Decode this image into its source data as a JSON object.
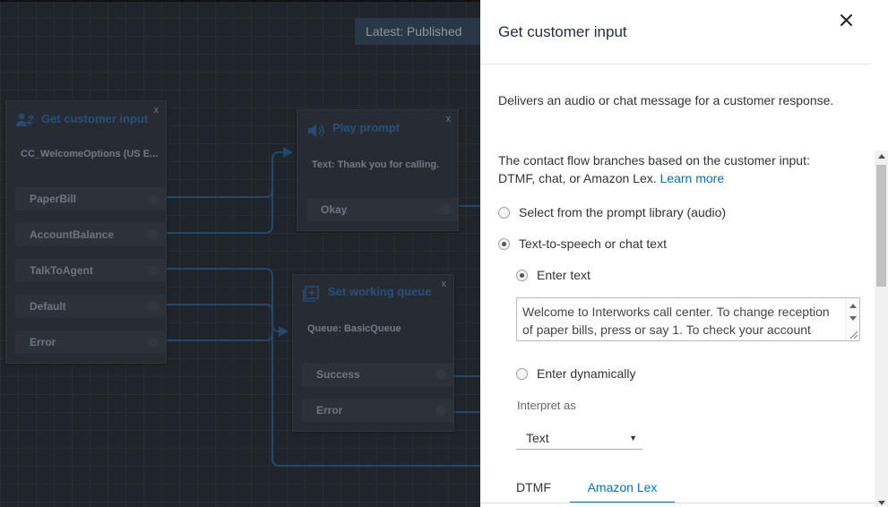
{
  "canvas": {
    "version_badge": "Latest: Published",
    "blocks": {
      "get_customer_input": {
        "title": "Get customer input",
        "subtitle": "CC_WelcomeOptions (US E...",
        "branches": [
          "PaperBill",
          "AccountBalance",
          "TalkToAgent",
          "Default",
          "Error"
        ]
      },
      "play_prompt": {
        "title": "Play prompt",
        "subtitle": "Text: Thank you for calling.",
        "branches": [
          "Okay"
        ]
      },
      "set_working_queue": {
        "title": "Set working queue",
        "subtitle": "Queue: BasicQueue",
        "branches": [
          "Success",
          "Error"
        ]
      }
    },
    "close_glyph": "x"
  },
  "panel": {
    "title": "Get customer input",
    "description": "Delivers an audio or chat message for a customer response.",
    "branch_text": "The contact flow branches based on the customer input: DTMF, chat, or Amazon Lex.",
    "learn_more": "Learn more",
    "source_options": [
      {
        "label": "Select from the prompt library (audio)",
        "selected": false
      },
      {
        "label": "Text-to-speech or chat text",
        "selected": true
      }
    ],
    "text_options": [
      {
        "label": "Enter text",
        "selected": true
      },
      {
        "label": "Enter dynamically",
        "selected": false
      }
    ],
    "text_value": "Welcome to Interworks call center. To change reception of paper bills, press or say 1. To check your account",
    "interpret_label": "Interpret as",
    "interpret_value": "Text",
    "caret": "▼",
    "tabs": [
      {
        "label": "DTMF",
        "active": false
      },
      {
        "label": "Amazon Lex",
        "active": true
      }
    ]
  },
  "colors": {
    "link": "#0073bb",
    "block_title": "#27507b",
    "wire": "#24476d"
  }
}
